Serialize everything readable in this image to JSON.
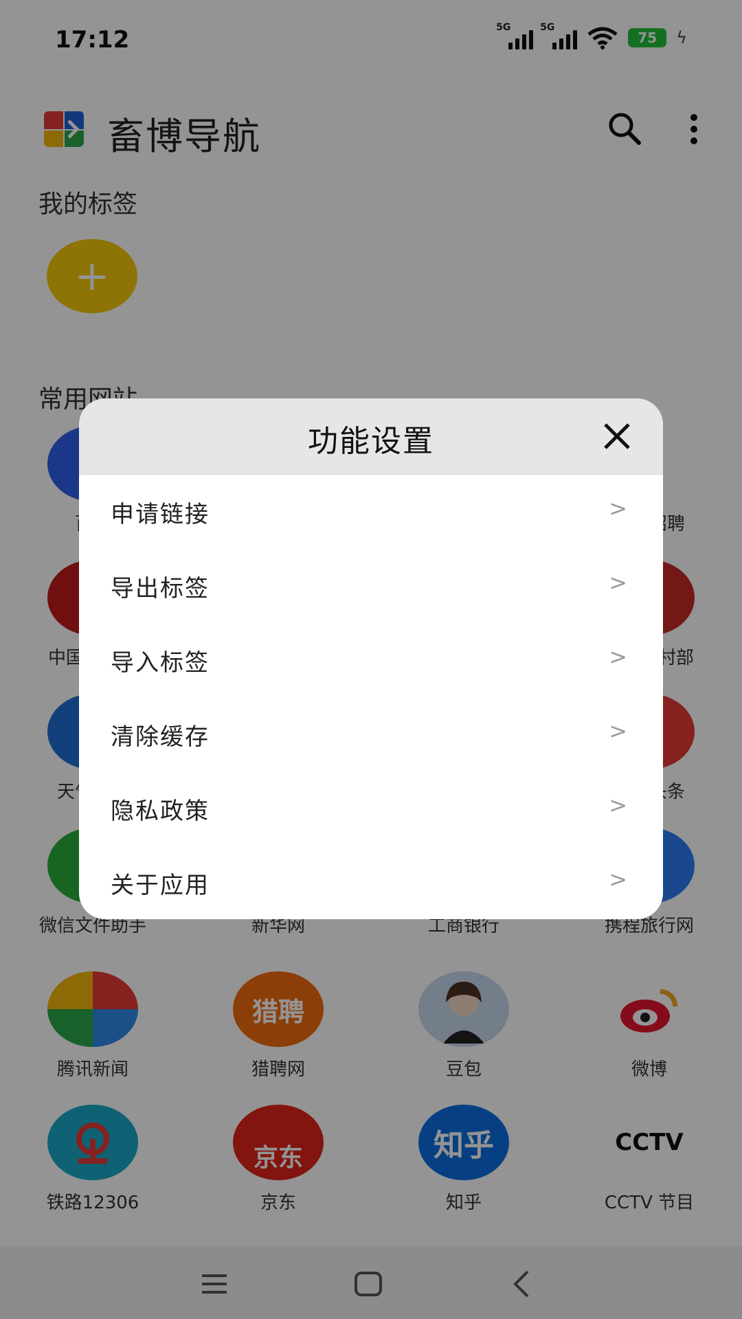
{
  "status_bar": {
    "time": "17:12",
    "net1": "5G",
    "net2": "5G",
    "battery": "75"
  },
  "header": {
    "title": "畜博导航",
    "search_icon": "search-icon",
    "more_icon": "more-vert-icon"
  },
  "my_tags": {
    "title": "我的标签",
    "add_label": "+"
  },
  "common_sites": {
    "title": "常用网站",
    "rows": [
      [
        {
          "label": "百度",
          "color": "#2f5fe8",
          "glyph": ""
        },
        {
          "label": "",
          "color": "#ffffff",
          "glyph": ""
        },
        {
          "label": "",
          "color": "#ffffff",
          "glyph": ""
        },
        {
          "label": "智联招聘",
          "color": "#ffffff",
          "glyph": "联"
        }
      ],
      [
        {
          "label": "中国政府网",
          "color": "#c21b1b",
          "glyph": ""
        },
        {
          "label": "",
          "color": "#ffffff",
          "glyph": ""
        },
        {
          "label": "",
          "color": "#ffffff",
          "glyph": ""
        },
        {
          "label": "农业农村部",
          "color": "#c62828",
          "glyph": ""
        }
      ],
      [
        {
          "label": "天气预报",
          "color": "#1f6ed4",
          "glyph": ""
        },
        {
          "label": "",
          "color": "#ffffff",
          "glyph": ""
        },
        {
          "label": "",
          "color": "#ffffff",
          "glyph": ""
        },
        {
          "label": "今日头条",
          "color": "#e53935",
          "glyph": "条"
        }
      ],
      [
        {
          "label": "微信文件助手",
          "color": "#2aae3a",
          "glyph": ""
        },
        {
          "label": "新华网",
          "color": "#ffffff",
          "glyph": ""
        },
        {
          "label": "工商银行",
          "color": "#ffffff",
          "glyph": ""
        },
        {
          "label": "携程旅行网",
          "color": "#2e7cf6",
          "glyph": ""
        }
      ],
      [
        {
          "label": "腾讯新闻",
          "color": "#2e8be6",
          "glyph": ""
        },
        {
          "label": "猎聘网",
          "color": "#f26b0f",
          "glyph": "猎聘"
        },
        {
          "label": "豆包",
          "color": "#c9d8ee",
          "glyph": ""
        },
        {
          "label": "微博",
          "color": "#ffffff",
          "glyph": ""
        }
      ],
      [
        {
          "label": "铁路12306",
          "color": "#1ba9c9",
          "glyph": ""
        },
        {
          "label": "京东",
          "color": "#e1251b",
          "glyph": "京东"
        },
        {
          "label": "知乎",
          "color": "#0d6fe0",
          "glyph": "知乎"
        },
        {
          "label": "CCTV 节目",
          "color": "#ffffff",
          "glyph": "CCTV"
        }
      ]
    ]
  },
  "dialog": {
    "title": "功能设置",
    "close_icon": "close-icon",
    "items": [
      {
        "label": "申请链接",
        "arrow": ">"
      },
      {
        "label": "导出标签",
        "arrow": ">"
      },
      {
        "label": "导入标签",
        "arrow": ">"
      },
      {
        "label": "清除缓存",
        "arrow": ">"
      },
      {
        "label": "隐私政策",
        "arrow": ">"
      },
      {
        "label": "关于应用",
        "arrow": ">"
      }
    ]
  },
  "nav_bar": {
    "menu_icon": "menu-icon",
    "home_icon": "home-icon",
    "back_icon": "back-icon"
  }
}
